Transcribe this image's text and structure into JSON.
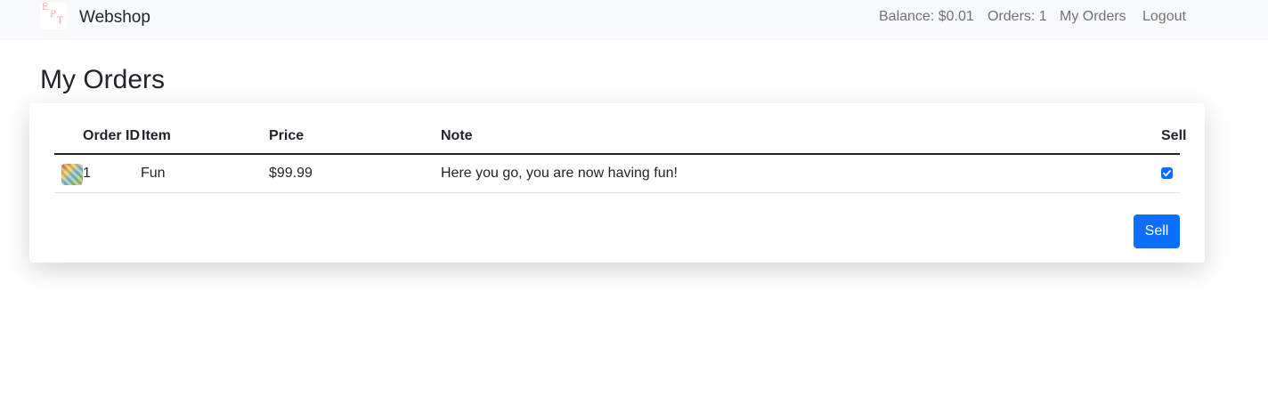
{
  "app": {
    "logo_text": "EPT",
    "brand": "Webshop"
  },
  "nav": {
    "balance": "Balance: $0.01",
    "orders_count": "Orders: 1",
    "my_orders": "My Orders",
    "logout": "Logout"
  },
  "page": {
    "title": "My Orders"
  },
  "table": {
    "columns": [
      "Order ID",
      "Item",
      "Price",
      "Note",
      "Sell"
    ],
    "rows": [
      {
        "order_id": "1",
        "item": "Fun",
        "price": "$99.99",
        "note": "Here you go, you are now having fun!",
        "sell_checked": true
      }
    ]
  },
  "actions": {
    "sell_button": "Sell"
  },
  "colors": {
    "primary": "#0d6efd",
    "navbar_bg": "#f8f9fa",
    "text": "#212529"
  }
}
